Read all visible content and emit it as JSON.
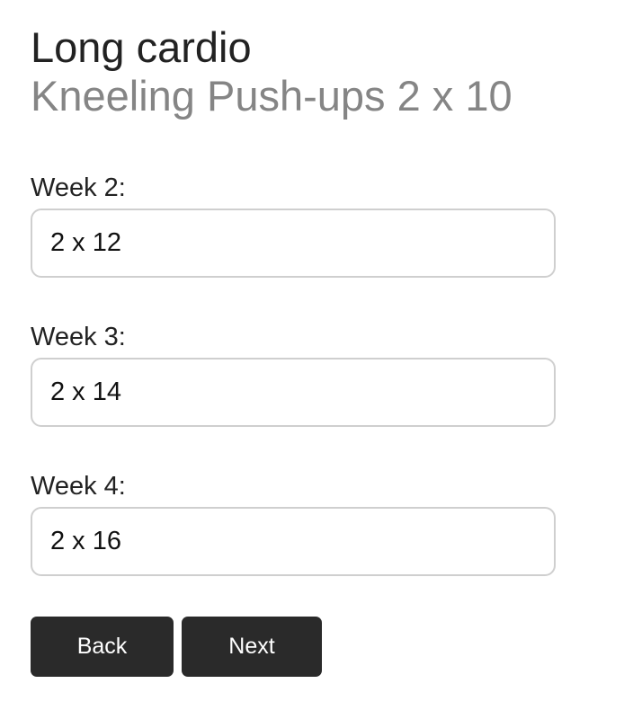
{
  "header": {
    "title": "Long cardio",
    "subtitle": "Kneeling Push-ups 2 x 10"
  },
  "fields": [
    {
      "label": "Week 2:",
      "value": "2 x 12"
    },
    {
      "label": "Week 3:",
      "value": "2 x 14"
    },
    {
      "label": "Week 4:",
      "value": "2 x 16"
    }
  ],
  "actions": {
    "back_label": "Back",
    "next_label": "Next"
  },
  "colors": {
    "title": "#222222",
    "subtitle": "#858585",
    "button_bg": "#2a2a2a",
    "button_text": "#ffffff",
    "input_border": "#cfcfcf"
  }
}
